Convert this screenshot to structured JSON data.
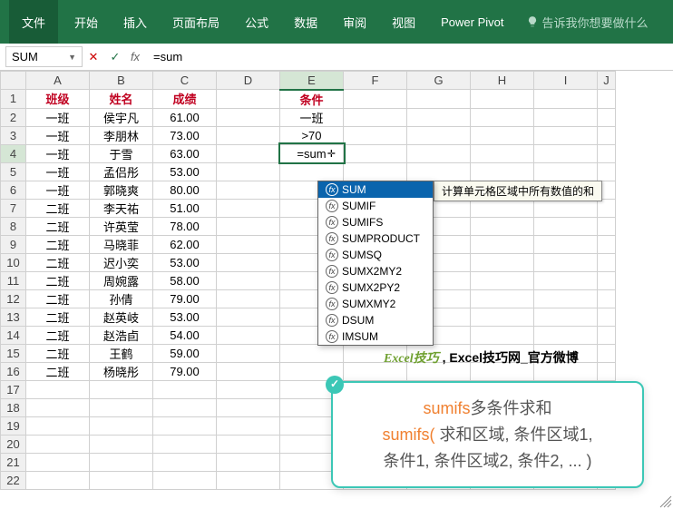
{
  "ribbon": {
    "tabs": [
      "文件",
      "开始",
      "插入",
      "页面布局",
      "公式",
      "数据",
      "审阅",
      "视图",
      "Power Pivot"
    ],
    "tell": "告诉我你想要做什么"
  },
  "namebox": "SUM",
  "formula": "=sum",
  "colHeaders": [
    "A",
    "B",
    "C",
    "D",
    "E",
    "F",
    "G",
    "H",
    "I",
    "J"
  ],
  "tableHeaders": {
    "a": "班级",
    "b": "姓名",
    "c": "成绩",
    "e": "条件"
  },
  "condVals": {
    "e2": "一班",
    "e3": ">70",
    "e4": "=sum"
  },
  "rows": [
    {
      "b": "一班",
      "n": "侯宇凡",
      "c": "61.00"
    },
    {
      "b": "一班",
      "n": "李朋林",
      "c": "73.00"
    },
    {
      "b": "一班",
      "n": "于雪",
      "c": "63.00"
    },
    {
      "b": "一班",
      "n": "孟侣彤",
      "c": "53.00"
    },
    {
      "b": "一班",
      "n": "郭晓爽",
      "c": "80.00"
    },
    {
      "b": "二班",
      "n": "李天祐",
      "c": "51.00"
    },
    {
      "b": "二班",
      "n": "许英莹",
      "c": "78.00"
    },
    {
      "b": "二班",
      "n": "马晓菲",
      "c": "62.00"
    },
    {
      "b": "二班",
      "n": "迟小奕",
      "c": "53.00"
    },
    {
      "b": "二班",
      "n": "周婉露",
      "c": "58.00"
    },
    {
      "b": "二班",
      "n": "孙倩",
      "c": "79.00"
    },
    {
      "b": "二班",
      "n": "赵英岐",
      "c": "53.00"
    },
    {
      "b": "二班",
      "n": "赵浩卣",
      "c": "54.00"
    },
    {
      "b": "二班",
      "n": "王鹤",
      "c": "59.00"
    },
    {
      "b": "二班",
      "n": "杨晓彤",
      "c": "79.00"
    }
  ],
  "autocomplete": [
    "SUM",
    "SUMIF",
    "SUMIFS",
    "SUMPRODUCT",
    "SUMSQ",
    "SUMX2MY2",
    "SUMX2PY2",
    "SUMXMY2",
    "DSUM",
    "IMSUM"
  ],
  "ac_selected": 0,
  "tooltip": "计算单元格区域中所有数值的和",
  "watermark": {
    "logo": "Excel技巧",
    "text": ", Excel技巧网_官方微博"
  },
  "hint": {
    "l1a": "sumifs",
    "l1b": "多条件求和",
    "l2a": "sumifs(",
    "l2b": " 求和区域",
    "l3a": "条件1",
    "l3b": "条件区域1",
    "l3c": "条件区域2",
    "l3d": "条件2",
    "l3e": ", ... )"
  }
}
